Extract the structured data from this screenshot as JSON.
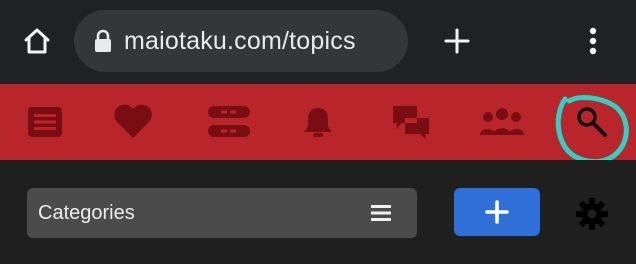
{
  "browser": {
    "url": "maiotaku.com/topics",
    "icons": [
      "home-icon",
      "lock-icon",
      "new-tab-icon",
      "more-vert-icon"
    ]
  },
  "nav": {
    "items": [
      {
        "icon": "menu-list-icon"
      },
      {
        "icon": "heart-icon"
      },
      {
        "icon": "toggle-list-icon"
      },
      {
        "icon": "bell-icon"
      },
      {
        "icon": "chat-icon"
      },
      {
        "icon": "users-icon"
      },
      {
        "icon": "search-icon"
      }
    ],
    "bar_color": "#b8262c",
    "icon_color": "#7a0d12",
    "highlight_color": "#2fd1c4"
  },
  "toolbar": {
    "categories_label": "Categories",
    "add_button_color": "#2f6fd8"
  }
}
